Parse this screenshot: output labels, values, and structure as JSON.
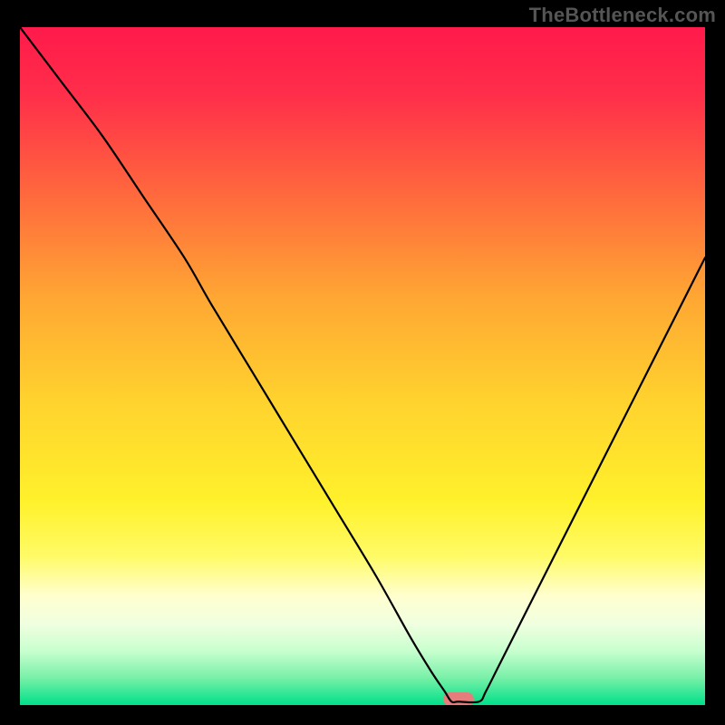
{
  "watermark": "TheBottleneck.com",
  "chart_data": {
    "type": "line",
    "title": "",
    "xlabel": "",
    "ylabel": "",
    "xlim": [
      0,
      100
    ],
    "ylim": [
      0,
      100
    ],
    "grid": false,
    "legend": false,
    "gradient_stops": [
      {
        "offset": 0.0,
        "color": "#ff1a4b"
      },
      {
        "offset": 0.1,
        "color": "#ff2e4a"
      },
      {
        "offset": 0.25,
        "color": "#ff6a3d"
      },
      {
        "offset": 0.4,
        "color": "#ffa733"
      },
      {
        "offset": 0.55,
        "color": "#ffd22e"
      },
      {
        "offset": 0.7,
        "color": "#fff12b"
      },
      {
        "offset": 0.78,
        "color": "#fffb66"
      },
      {
        "offset": 0.84,
        "color": "#ffffd0"
      },
      {
        "offset": 0.88,
        "color": "#f0ffe0"
      },
      {
        "offset": 0.92,
        "color": "#c8ffcf"
      },
      {
        "offset": 0.96,
        "color": "#78f0a8"
      },
      {
        "offset": 1.0,
        "color": "#00e08a"
      }
    ],
    "series": [
      {
        "name": "bottleneck-curve",
        "x": [
          0,
          6,
          12,
          18,
          24,
          28,
          34,
          40,
          46,
          52,
          57,
          60,
          62,
          63,
          64,
          67,
          68,
          70,
          74,
          80,
          86,
          92,
          98,
          100
        ],
        "values": [
          100,
          92,
          84,
          75,
          66,
          59,
          49,
          39,
          29,
          19,
          10,
          5,
          2,
          0.5,
          0.5,
          0.5,
          2,
          6,
          14,
          26,
          38,
          50,
          62,
          66
        ]
      }
    ],
    "marker": {
      "name": "optimal-marker",
      "x": 64,
      "y": 0,
      "width": 4.5,
      "height": 2,
      "color": "#e77c7c"
    }
  }
}
